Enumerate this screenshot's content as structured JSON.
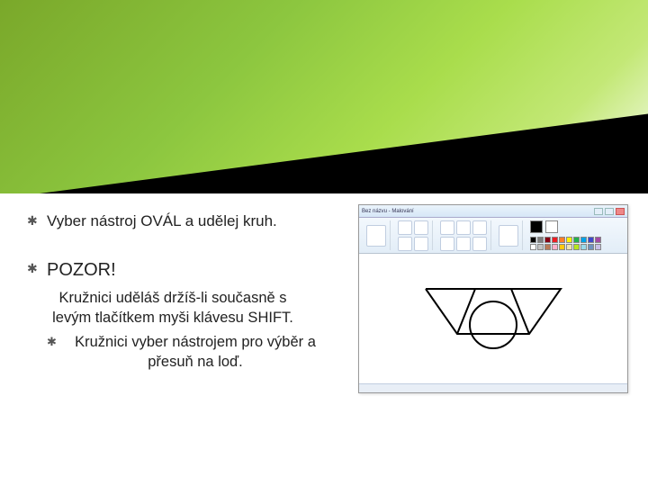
{
  "bullets": {
    "b1": "Vyber nástroj OVÁL a udělej kruh.",
    "b2": "POZOR!",
    "sub1": "Kružnici uděláš držíš-li současně s levým tlačítkem myši klávesu SHIFT.",
    "sub2": "Kružnici vyber nástrojem pro výběr a přesuň na loď."
  },
  "paint": {
    "title": "Bez názvu - Malování",
    "palette": [
      "#000",
      "#7f7f7f",
      "#880015",
      "#ed1c24",
      "#ff7f27",
      "#fff200",
      "#22b14c",
      "#00a2e8",
      "#3f48cc",
      "#a349a4",
      "#fff",
      "#c3c3c3",
      "#b97a57",
      "#ffaec9",
      "#ffc90e",
      "#efe4b0",
      "#b5e61d",
      "#99d9ea",
      "#7092be",
      "#c8bfe7"
    ]
  }
}
